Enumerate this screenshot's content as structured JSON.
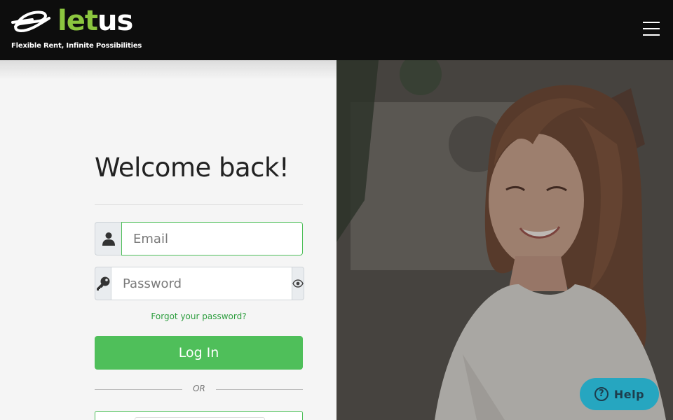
{
  "header": {
    "logo_let": "let",
    "logo_us": "us",
    "tagline": "Flexible Rent, Infinite Possibilities",
    "menu_icon": "hamburger-menu-icon"
  },
  "login": {
    "title": "Welcome back!",
    "email_placeholder": "Email",
    "email_icon": "user-icon",
    "password_placeholder": "Password",
    "password_icon": "key-icon",
    "show_password_icon": "eye-icon",
    "forgot_label": "Forgot your password?",
    "login_label": "Log In",
    "or_label": "OR"
  },
  "help": {
    "icon": "question-icon",
    "symbol": "?",
    "label": "Help"
  },
  "colors": {
    "brand_green": "#4fbf5a",
    "logo_green": "#8cc63f",
    "header_bg": "#0d0d0d",
    "help_bg": "#26a6c0"
  }
}
